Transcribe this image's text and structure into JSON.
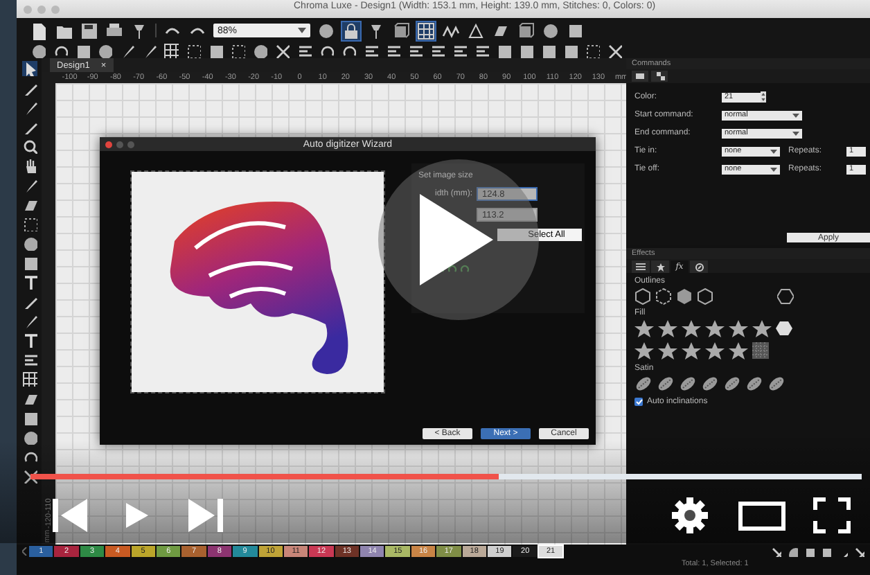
{
  "window": {
    "title": "Chroma Luxe - Design1 (Width: 153.1 mm, Height: 139.0 mm, Stitches: 0, Colors: 0)"
  },
  "toolbar": {
    "zoom": "88%"
  },
  "document_tabs": [
    {
      "label": "Design1",
      "close": "×",
      "selected": true
    }
  ],
  "ruler": {
    "ticks": [
      "-100",
      "-90",
      "-80",
      "-70",
      "-60",
      "-50",
      "-40",
      "-30",
      "-20",
      "-10",
      "0",
      "10",
      "20",
      "30",
      "40",
      "50",
      "60",
      "70",
      "80",
      "90",
      "100",
      "110",
      "120",
      "130"
    ],
    "unit": "mm",
    "side_ticks": [
      "-110",
      "-120"
    ],
    "side_unit": "mm"
  },
  "wizard": {
    "title": "Auto digitizer Wizard",
    "section": "Set image size",
    "width_label": "idth (mm):",
    "width_value": "124.8",
    "height_value": "113.2",
    "select_button": "Select All",
    "buttons": [
      {
        "label": "< Back",
        "default": false
      },
      {
        "label": "Next >",
        "default": true
      },
      {
        "label": "Cancel",
        "default": false
      }
    ]
  },
  "commands": {
    "title": "Commands",
    "rows": [
      {
        "kind": "spin",
        "label": "Color:",
        "value": "21"
      },
      {
        "kind": "select",
        "label": "Start command:",
        "value": "normal"
      },
      {
        "kind": "select",
        "label": "End command:",
        "value": "normal"
      },
      {
        "kind": "pair",
        "label": "Tie in:",
        "value": "none",
        "repeat_label": "Repeats:",
        "repeat_value": "1"
      },
      {
        "kind": "pair",
        "label": "Tie off:",
        "value": "none",
        "repeat_label": "Repeats:",
        "repeat_value": "1"
      }
    ],
    "apply": "Apply"
  },
  "effects": {
    "title": "Effects",
    "tabs": [
      {
        "kind": "list",
        "selected": false
      },
      {
        "kind": "star",
        "selected": false
      },
      {
        "kind": "text",
        "label": "fx",
        "selected": true
      },
      {
        "kind": "compass",
        "selected": false
      }
    ],
    "sections": [
      {
        "kind": "outlines",
        "title": "Outlines"
      },
      {
        "kind": "fill",
        "title": "Fill"
      },
      {
        "kind": "satin",
        "title": "Satin"
      }
    ],
    "auto_inclinations": {
      "label": "Auto inclinations",
      "checked": true
    }
  },
  "palette": [
    {
      "label": "1",
      "color": "#2a5f9e",
      "selected": false
    },
    {
      "label": "2",
      "color": "#a8243e",
      "selected": false
    },
    {
      "label": "3",
      "color": "#2e8a45",
      "selected": false
    },
    {
      "label": "4",
      "color": "#c85a22",
      "selected": false
    },
    {
      "label": "5",
      "color": "#bba52a",
      "selected": false
    },
    {
      "label": "6",
      "color": "#6f9a42",
      "selected": false
    },
    {
      "label": "7",
      "color": "#a8612f",
      "selected": false
    },
    {
      "label": "8",
      "color": "#8c3470",
      "selected": false
    },
    {
      "label": "9",
      "color": "#23899a",
      "selected": false
    },
    {
      "label": "10",
      "color": "#bfa337",
      "selected": false
    },
    {
      "label": "11",
      "color": "#c88578",
      "selected": false
    },
    {
      "label": "12",
      "color": "#c93854",
      "selected": false
    },
    {
      "label": "13",
      "color": "#6e3226",
      "selected": false
    },
    {
      "label": "14",
      "color": "#8f84ae",
      "selected": false
    },
    {
      "label": "15",
      "color": "#a9b865",
      "selected": false
    },
    {
      "label": "16",
      "color": "#c98446",
      "selected": false
    },
    {
      "label": "17",
      "color": "#7f8d46",
      "selected": false
    },
    {
      "label": "18",
      "color": "#baa998",
      "selected": false
    },
    {
      "label": "19",
      "color": "#cfcfcf",
      "selected": false
    },
    {
      "label": "20",
      "color": "#1b1b1b",
      "selected": false
    },
    {
      "label": "21",
      "color": "#dcdcdc",
      "selected": true
    }
  ],
  "status_bar": {
    "text": "Total: 1, Selected: 1"
  },
  "player": {
    "progress": {
      "level": 0.563
    }
  }
}
